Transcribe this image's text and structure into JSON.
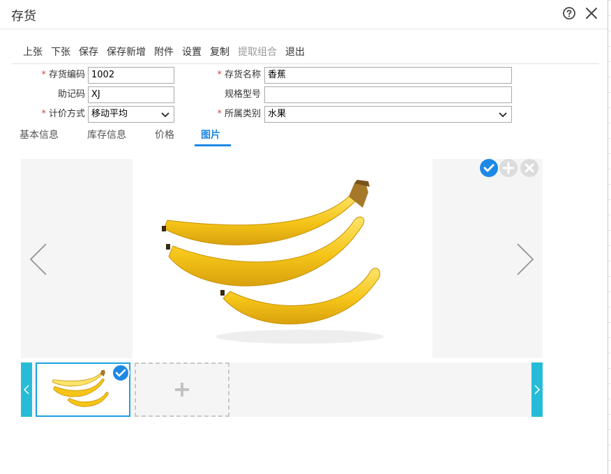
{
  "dialog": {
    "title": "存货"
  },
  "toolbar": {
    "items": [
      {
        "label": "上张",
        "enabled": true
      },
      {
        "label": "下张",
        "enabled": true
      },
      {
        "label": "保存",
        "enabled": true
      },
      {
        "label": "保存新增",
        "enabled": true
      },
      {
        "label": "附件",
        "enabled": true
      },
      {
        "label": "设置",
        "enabled": true
      },
      {
        "label": "复制",
        "enabled": true
      },
      {
        "label": "提取组合",
        "enabled": false
      },
      {
        "label": "退出",
        "enabled": true
      }
    ]
  },
  "form": {
    "code": {
      "label": "存货编码",
      "required_mark": "*",
      "value": "1002"
    },
    "name": {
      "label": "存货名称",
      "required_mark": "*",
      "value": "香蕉"
    },
    "mnemonic": {
      "label": "助记码",
      "value": "XJ"
    },
    "spec": {
      "label": "规格型号",
      "value": ""
    },
    "pricing": {
      "label": "计价方式",
      "required_mark": "*",
      "value": "移动平均"
    },
    "category": {
      "label": "所属类别",
      "required_mark": "*",
      "value": "水果"
    }
  },
  "tabs": [
    {
      "label": "基本信息",
      "active": false
    },
    {
      "label": "库存信息",
      "active": false
    },
    {
      "label": "价格",
      "active": false
    },
    {
      "label": "图片",
      "active": true
    }
  ],
  "gallery": {
    "image_subject": "banana",
    "thumbnails": [
      {
        "selected": true
      }
    ],
    "add_thumbnail_symbol": "+"
  },
  "colors": {
    "accent": "#1e88e5",
    "strip_nav": "#26bcd7",
    "required": "#e04040",
    "banana_yellow": "#f5c518"
  },
  "icons": {
    "help": "help-circle-icon",
    "close": "close-icon",
    "prev": "chevron-left-icon",
    "next": "chevron-right-icon",
    "check": "check-icon",
    "add": "plus-icon",
    "delete": "x-icon"
  }
}
